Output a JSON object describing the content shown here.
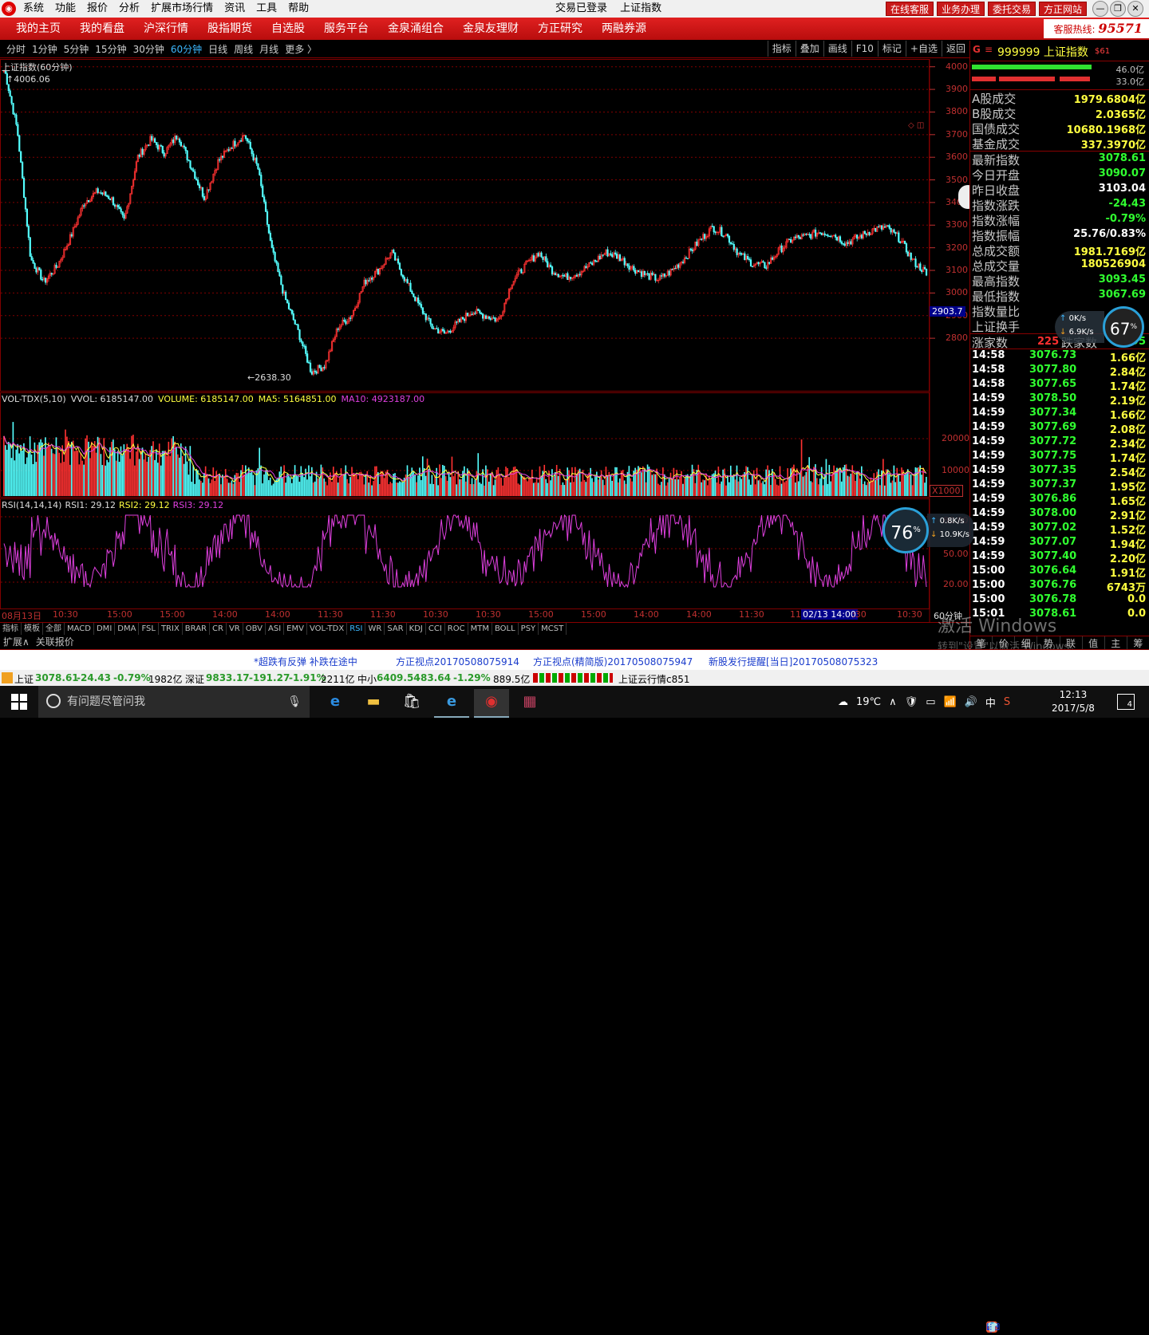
{
  "titlebar": {
    "menus": [
      "系统",
      "功能",
      "报价",
      "分析",
      "扩展市场行情",
      "资讯",
      "工具",
      "帮助"
    ],
    "status": "交易已登录",
    "security": "上证指数",
    "right_buttons": [
      "在线客服",
      "业务办理",
      "委托交易",
      "方正网站"
    ],
    "window_controls": [
      "—",
      "❐",
      "✕"
    ]
  },
  "navbar": {
    "items": [
      "我的主页",
      "我的看盘",
      "沪深行情",
      "股指期货",
      "自选股",
      "服务平台",
      "金泉涌组合",
      "金泉友理财",
      "方正研究",
      "两融券源"
    ],
    "hotline_label": "客服热线:",
    "hotline_number": "95571"
  },
  "periodbar": {
    "periods": [
      "分时",
      "1分钟",
      "5分钟",
      "15分钟",
      "30分钟",
      "60分钟",
      "日线",
      "周线",
      "月线",
      "更多 〉"
    ],
    "active_index": 5,
    "tools": [
      "指标",
      "叠加",
      "画线",
      "F10",
      "标记",
      "+自选",
      "返回"
    ]
  },
  "chart": {
    "main_title": "上证指数(60分钟)",
    "high_label": "4006.06",
    "low_label": "←2638.30",
    "price_axis": [
      "4000",
      "3900",
      "3800",
      "3700",
      "3600",
      "3500",
      "3400",
      "3300",
      "3200",
      "3100",
      "3000",
      "2900",
      "2800"
    ],
    "current_price": "2903.7",
    "volume_title": [
      "VOL-TDX(5,10)",
      "VVOL: 6185147.00",
      "VOLUME: 6185147.00",
      "MA5: 5164851.00",
      "MA10: 4923187.00"
    ],
    "volume_axis": [
      "20000",
      "10000"
    ],
    "volume_unit": "X1000",
    "rsi_title": [
      "RSI(14,14,14)",
      "RSI1: 29.12",
      "RSI2: 29.12",
      "RSI3: 29.12"
    ],
    "rsi_axis": [
      "80.00",
      "50.00",
      "20.00"
    ],
    "x_labels": [
      "08月13日",
      "10:30",
      "15:00",
      "15:00",
      "14:00",
      "14:00",
      "11:30",
      "11:30",
      "10:30",
      "10:30",
      "15:00",
      "15:00",
      "14:00",
      "14:00",
      "11:30",
      "11",
      "02/13 14:00",
      ":30",
      "10:30",
      "60分钟"
    ],
    "colors": {
      "up": "#ff3232",
      "down": "#54ffff",
      "grid": "#800000",
      "rsi": "#e040e0",
      "ma5": "#ffff40",
      "ma10": "#e040e0"
    }
  },
  "chart_data": {
    "type": "candlestick",
    "title": "上证指数(60分钟)",
    "high": 4006.06,
    "low": 2638.3,
    "last": 3078.61,
    "ylim": [
      2638.3,
      4006.06
    ],
    "price_axis_ticks": [
      4000,
      3900,
      3800,
      3700,
      3600,
      3500,
      3400,
      3300,
      3200,
      3100,
      3000,
      2900,
      2800
    ],
    "path_anchors": [
      4000,
      3720,
      3150,
      3050,
      3120,
      3250,
      3400,
      3450,
      3420,
      3320,
      3600,
      3680,
      3620,
      3700,
      3560,
      3420,
      3580,
      3650,
      3700,
      3550,
      3200,
      2980,
      2830,
      2650,
      2680,
      2850,
      2900,
      3050,
      3100,
      3180,
      3060,
      2950,
      2850,
      2820,
      2870,
      2920,
      2900,
      2880,
      3050,
      3120,
      3180,
      3100,
      3070,
      3090,
      3130,
      3180,
      3160,
      3110,
      3080,
      3060,
      3100,
      3160,
      3230,
      3290,
      3260,
      3170,
      3130,
      3120,
      3190,
      3240,
      3250,
      3270,
      3260,
      3220,
      3250,
      3280,
      3290,
      3240,
      3140,
      3090
    ],
    "volume_ticks": [
      20000,
      10000
    ],
    "rsi_ticks": [
      80,
      50,
      20
    ],
    "rsi_last": 29.12
  },
  "quote": {
    "flag": "G",
    "menu_glyph": "≡",
    "code_name": "999999 上证指数",
    "tag": "$61",
    "bar_vals": [
      "46.0亿",
      "33.0亿"
    ],
    "market_rows": [
      {
        "k": "A股成交",
        "v": "1979.6804亿"
      },
      {
        "k": "B股成交",
        "v": "2.0365亿"
      },
      {
        "k": "国债成交",
        "v": "10680.1968亿"
      },
      {
        "k": "基金成交",
        "v": "337.3970亿"
      }
    ],
    "index_rows": [
      {
        "k": "最新指数",
        "v": "3078.61",
        "c": "grn"
      },
      {
        "k": "今日开盘",
        "v": "3090.07",
        "c": "grn"
      },
      {
        "k": "昨日收盘",
        "v": "3103.04",
        "c": "wht"
      },
      {
        "k": "指数涨跌",
        "v": "-24.43",
        "c": "grn"
      },
      {
        "k": "指数涨幅",
        "v": "-0.79%",
        "c": "grn"
      },
      {
        "k": "指数振幅",
        "v": "25.76/0.83%",
        "c": "wht"
      },
      {
        "k": "总成交额",
        "v": "1981.7169亿",
        "c": "yel"
      },
      {
        "k": "总成交量",
        "v": "180526904",
        "c": "yel"
      },
      {
        "k": "最高指数",
        "v": "3093.45",
        "c": "grn"
      },
      {
        "k": "最低指数",
        "v": "3067.69",
        "c": "grn"
      },
      {
        "k": "指数量比",
        "v": "",
        "c": "wht"
      },
      {
        "k": "上证换手",
        "v": "",
        "c": "wht"
      }
    ],
    "up_label": "涨家数",
    "up_count": "225",
    "down_label": "跌家数",
    "down_count": "595",
    "ticks": [
      {
        "t": "14:58",
        "p": "3076.73",
        "v": "1.66亿"
      },
      {
        "t": "14:58",
        "p": "3077.80",
        "v": "2.84亿"
      },
      {
        "t": "14:58",
        "p": "3077.65",
        "v": "1.74亿"
      },
      {
        "t": "14:59",
        "p": "3078.50",
        "v": "2.19亿"
      },
      {
        "t": "14:59",
        "p": "3077.34",
        "v": "1.66亿"
      },
      {
        "t": "14:59",
        "p": "3077.69",
        "v": "2.08亿"
      },
      {
        "t": "14:59",
        "p": "3077.72",
        "v": "2.34亿"
      },
      {
        "t": "14:59",
        "p": "3077.75",
        "v": "1.74亿"
      },
      {
        "t": "14:59",
        "p": "3077.35",
        "v": "2.54亿"
      },
      {
        "t": "14:59",
        "p": "3077.37",
        "v": "1.95亿"
      },
      {
        "t": "14:59",
        "p": "3076.86",
        "v": "1.65亿"
      },
      {
        "t": "14:59",
        "p": "3078.00",
        "v": "2.91亿"
      },
      {
        "t": "14:59",
        "p": "3077.02",
        "v": "1.52亿"
      },
      {
        "t": "14:59",
        "p": "3077.07",
        "v": "1.94亿"
      },
      {
        "t": "14:59",
        "p": "3077.40",
        "v": "2.20亿"
      },
      {
        "t": "15:00",
        "p": "3076.64",
        "v": "1.91亿"
      },
      {
        "t": "15:00",
        "p": "3076.76",
        "v": "6743万"
      },
      {
        "t": "15:00",
        "p": "3076.78",
        "v": "0.0"
      },
      {
        "t": "15:01",
        "p": "3078.61",
        "v": "0.0"
      }
    ],
    "footer": [
      "笔",
      "价",
      "细",
      "势",
      "联",
      "值",
      "主",
      "筹"
    ]
  },
  "speed1": {
    "pct": "67",
    "unit": "%",
    "up": "0K/s",
    "down": "6.9K/s"
  },
  "speed2": {
    "pct": "76",
    "unit": "%",
    "up": "0.8K/s",
    "down": "10.9K/s"
  },
  "indicators": [
    "指标",
    "模板",
    "全部",
    "MACD",
    "DMI",
    "DMA",
    "FSL",
    "TRIX",
    "BRAR",
    "CR",
    "VR",
    "OBV",
    "ASI",
    "EMV",
    "VOL-TDX",
    "RSI",
    "WR",
    "SAR",
    "KDJ",
    "CCI",
    "ROC",
    "MTM",
    "BOLL",
    "PSY",
    "MCST"
  ],
  "indicators_active": 15,
  "tabs2": [
    "扩展∧",
    "关联报价"
  ],
  "news": [
    "*超跌有反弹  补跌在途中",
    "方正视点20170508075914",
    "方正视点(精简版)20170508075947",
    "新股发行提醒[当日]20170508075323"
  ],
  "quotebar": {
    "sh_label": "上证",
    "sh_price": "3078.61",
    "sh_chg": "-24.43",
    "sh_pct": "-0.79%",
    "sh_amt": "1982亿",
    "sz_label": "深证",
    "sz_price": "9833.17",
    "sz_chg": "-191.27",
    "sz_pct": "-1.91%",
    "sz_amt": "2211亿",
    "zx_label": "中小",
    "zx_price": "6409.54",
    "zx_chg": "-83.64",
    "zx_pct": "-1.29%",
    "zx_amt": "889.5亿",
    "cloud": "上证云行情c851"
  },
  "watermark": {
    "line1": "激活 Windows",
    "line2": "转到\"设置\"以激活 Windows。"
  },
  "ime": [
    "中",
    "☾",
    "°,",
    "🎙",
    "⌨",
    "👕",
    "⁝⁝"
  ],
  "taskbar": {
    "search_placeholder": "有问题尽管问我",
    "weather": "19℃",
    "tray_icons": [
      "∧",
      "🛡",
      "▭",
      "📶",
      "🔊",
      "中",
      "S"
    ],
    "time": "12:13",
    "date": "2017/5/8",
    "notifications": "4"
  }
}
